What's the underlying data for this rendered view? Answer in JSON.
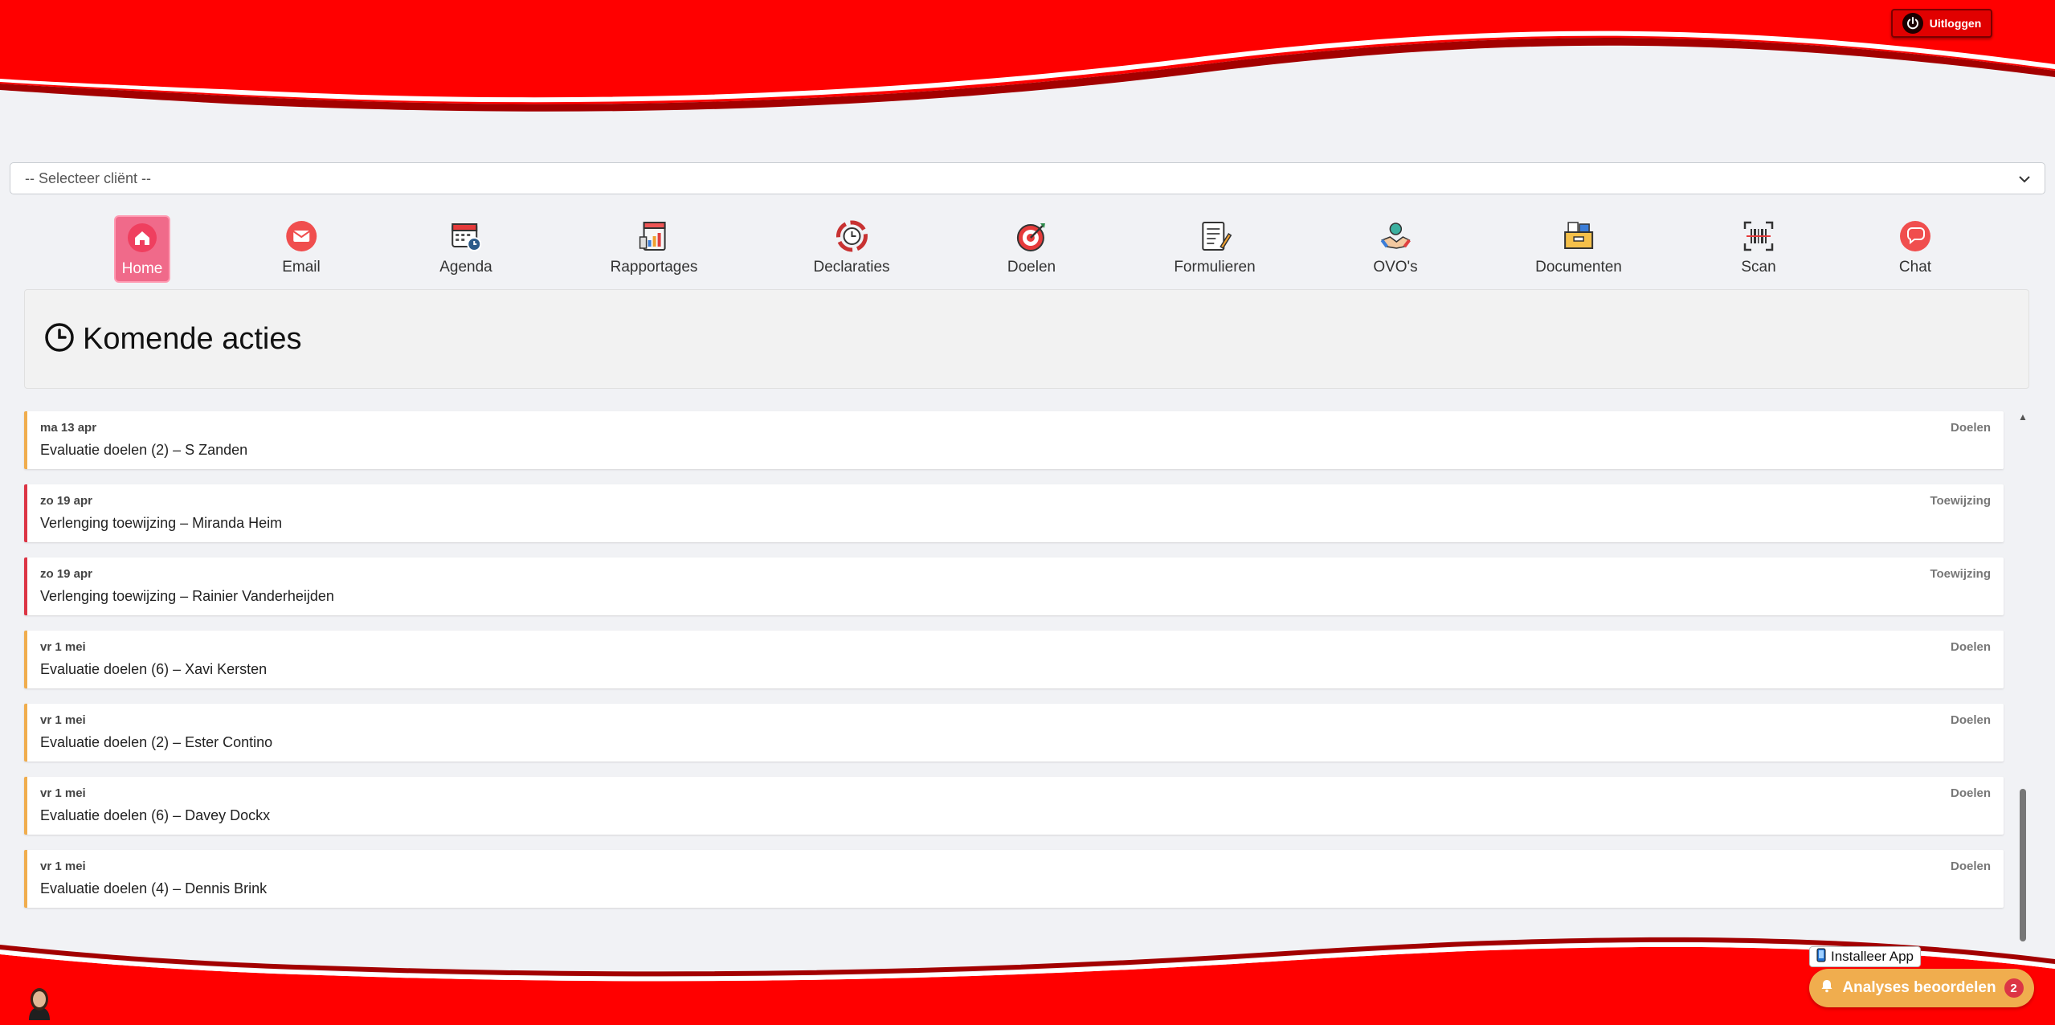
{
  "header": {
    "logout_label": "Uitloggen"
  },
  "client_select": {
    "value": "-- Selecteer cliënt --"
  },
  "nav": [
    {
      "label": "Home",
      "icon": "home-icon",
      "active": true
    },
    {
      "label": "Email",
      "icon": "email-icon"
    },
    {
      "label": "Agenda",
      "icon": "calendar-icon"
    },
    {
      "label": "Rapportages",
      "icon": "report-icon"
    },
    {
      "label": "Declaraties",
      "icon": "declarations-icon"
    },
    {
      "label": "Doelen",
      "icon": "target-icon"
    },
    {
      "label": "Formulieren",
      "icon": "form-icon"
    },
    {
      "label": "OVO's",
      "icon": "handshake-icon"
    },
    {
      "label": "Documenten",
      "icon": "documents-icon"
    },
    {
      "label": "Scan",
      "icon": "scan-icon"
    },
    {
      "label": "Chat",
      "icon": "chat-icon"
    }
  ],
  "panel": {
    "title": "Komende acties",
    "icon": "clock-icon"
  },
  "actions": [
    {
      "date": "ma 13 apr",
      "title": "Evaluatie doelen (2) – S Zanden",
      "category": "Doelen",
      "status": "warning"
    },
    {
      "date": "zo 19 apr",
      "title": "Verlenging toewijzing – Miranda Heim",
      "category": "Toewijzing",
      "status": "danger"
    },
    {
      "date": "zo 19 apr",
      "title": "Verlenging toewijzing – Rainier Vanderheijden",
      "category": "Toewijzing",
      "status": "danger"
    },
    {
      "date": "vr 1 mei",
      "title": "Evaluatie doelen (6) – Xavi Kersten",
      "category": "Doelen",
      "status": "warning"
    },
    {
      "date": "vr 1 mei",
      "title": "Evaluatie doelen (2) – Ester Contino",
      "category": "Doelen",
      "status": "warning"
    },
    {
      "date": "vr 1 mei",
      "title": "Evaluatie doelen (6) – Davey Dockx",
      "category": "Doelen",
      "status": "warning"
    },
    {
      "date": "vr 1 mei",
      "title": "Evaluatie doelen (4) – Dennis Brink",
      "category": "Doelen",
      "status": "warning"
    }
  ],
  "footer": {
    "install_label": "Installeer App",
    "analyses_label": "Analyses beoordelen",
    "analyses_count": "2"
  },
  "colors": {
    "brand_red": "#ff0000",
    "warning": "#f0ad4e",
    "danger": "#dc3545",
    "active_nav": "#f06a8a"
  }
}
